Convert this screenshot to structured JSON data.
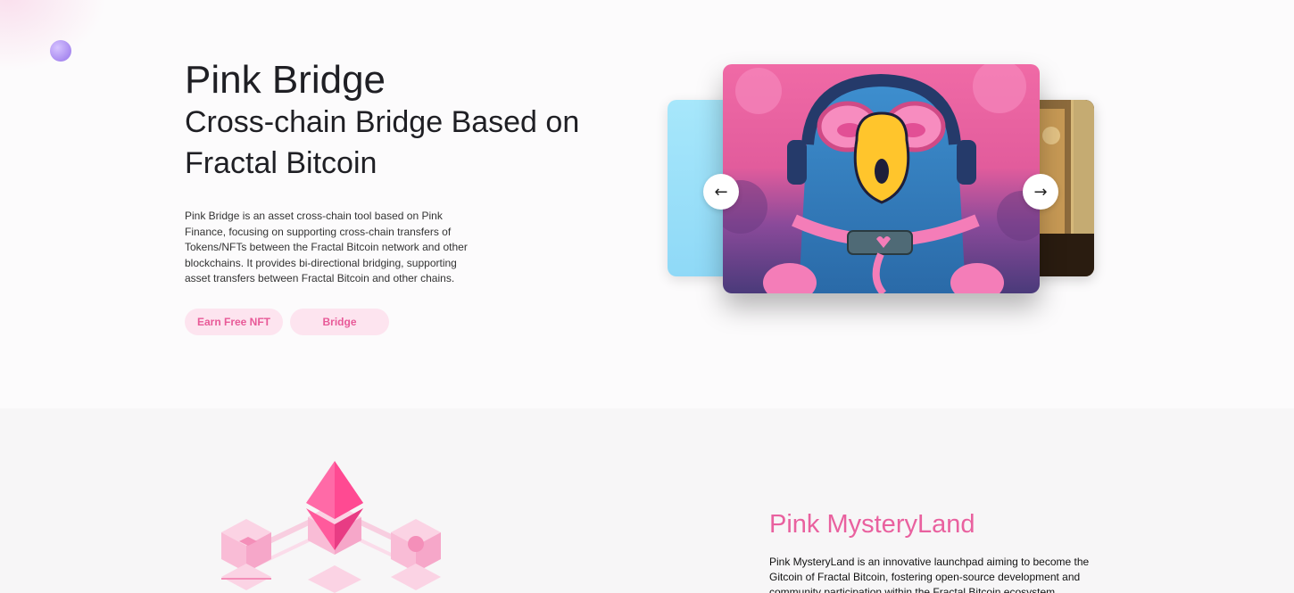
{
  "hero": {
    "title": "Pink Bridge",
    "subtitle": "Cross-chain Bridge Based on Fractal Bitcoin",
    "description": "Pink Bridge is an asset cross-chain tool based on Pink Finance, focusing on supporting cross-chain transfers of Tokens/NFTs between the Fractal Bitcoin network and other blockchains. It provides bi-directional bridging, supporting asset transfers between Fractal Bitcoin and other chains.",
    "buttons": {
      "earn": "Earn Free NFT",
      "bridge": "Bridge"
    }
  },
  "carousel": {
    "prev_icon": "←",
    "next_icon": "→",
    "icon_names": {
      "prev": "arrow-left-icon",
      "next": "arrow-right-icon"
    }
  },
  "mysteryland": {
    "title": "Pink MysteryLand",
    "description": "Pink MysteryLand is an innovative launchpad aiming to become the Gitcoin of Fractal Bitcoin, fostering open-source development and community participation within the Fractal Bitcoin ecosystem."
  },
  "colors": {
    "accent": "#e9619f",
    "button_bg": "#fde4ef",
    "button_text": "#e85a98"
  }
}
